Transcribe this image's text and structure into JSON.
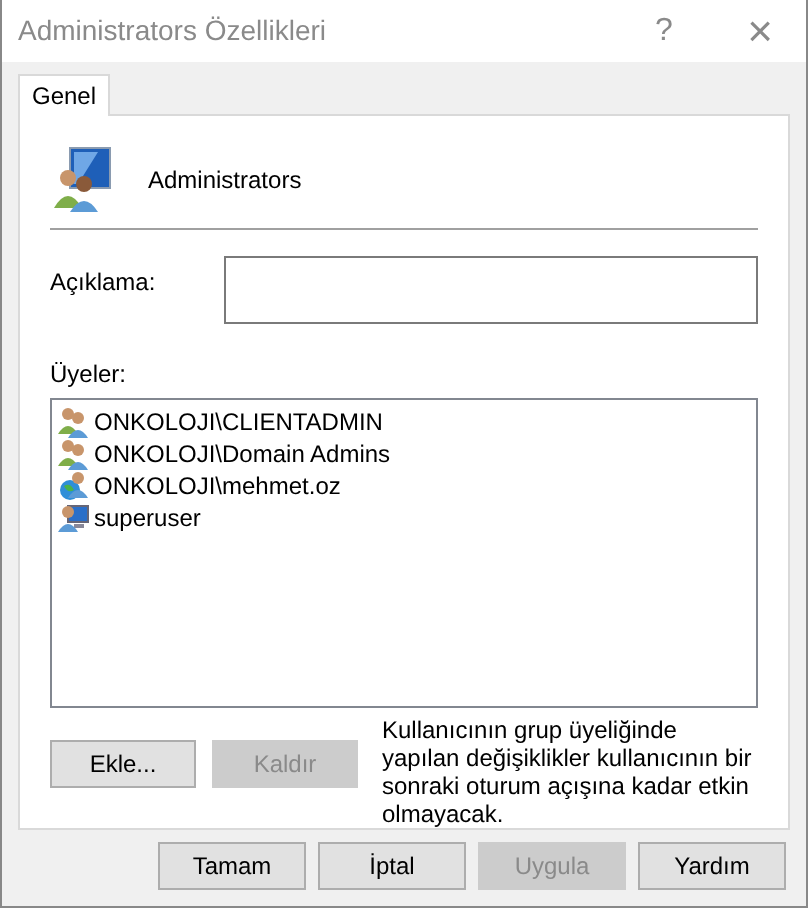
{
  "window": {
    "title": "Administrators Özellikleri",
    "help": "?",
    "close": "×"
  },
  "tabs": [
    {
      "label": "Genel",
      "selected": true
    }
  ],
  "group": {
    "name": "Administrators"
  },
  "description": {
    "label": "Açıklama:"
  },
  "members": {
    "label": "Üyeler:",
    "items": [
      {
        "name": "ONKOLOJI\\CLIENTADMIN",
        "kind": "group"
      },
      {
        "name": "ONKOLOJI\\Domain Admins",
        "kind": "group"
      },
      {
        "name": "ONKOLOJI\\mehmet.oz",
        "kind": "domain-user"
      },
      {
        "name": "superuser",
        "kind": "local-user"
      }
    ]
  },
  "member_buttons": [
    {
      "label": "Ekle...",
      "disabled": false
    },
    {
      "label": "Kaldır",
      "disabled": true
    }
  ],
  "note": "Kullanıcının grup üyeliğinde yapılan değişiklikler kullanıcının bir sonraki oturum açışına kadar etkin olmayacak.",
  "buttons": [
    {
      "label": "Tamam",
      "disabled": false
    },
    {
      "label": "İptal",
      "disabled": false
    },
    {
      "label": "Uygula",
      "disabled": true
    },
    {
      "label": "Yardım",
      "disabled": false
    }
  ]
}
